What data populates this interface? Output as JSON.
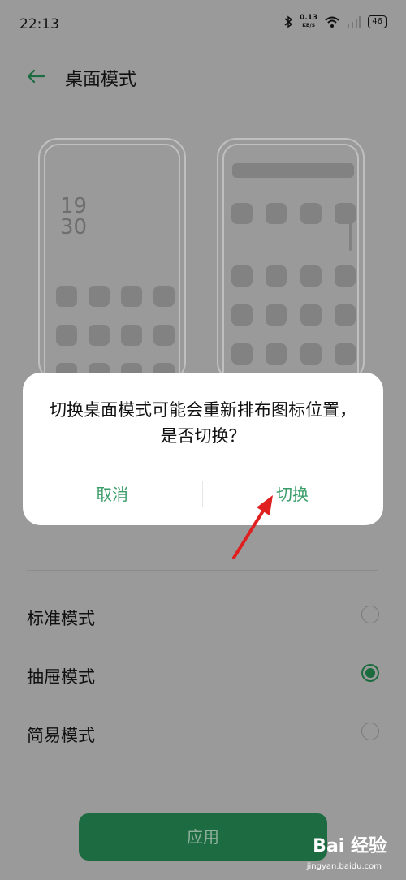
{
  "status_bar": {
    "time": "22:13",
    "net_speed_value": "0.13",
    "net_speed_unit": "KB/S",
    "battery": "46",
    "icons": [
      "bluetooth-icon",
      "wifi-icon",
      "signal-icon",
      "battery-icon"
    ]
  },
  "header": {
    "title": "桌面模式",
    "back_icon": "arrow-left-icon"
  },
  "preview_standard": {
    "clock_hour": "19",
    "clock_minute": "30"
  },
  "dialog": {
    "message": "切换桌面模式可能会重新排布图标位置，是否切换？",
    "cancel_label": "取消",
    "confirm_label": "切换"
  },
  "modes": [
    {
      "label": "标准模式",
      "selected": false
    },
    {
      "label": "抽屉模式",
      "selected": true
    },
    {
      "label": "简易模式",
      "selected": false
    }
  ],
  "apply_label": "应用",
  "watermark": {
    "brand": "Bai 经验",
    "url": "jingyan.baidu.com"
  },
  "colors": {
    "accent": "#3a9d68",
    "selected_radio": "#1a6b3e",
    "apply_button": "#1d6b40",
    "annotation_arrow": "#e02020"
  }
}
